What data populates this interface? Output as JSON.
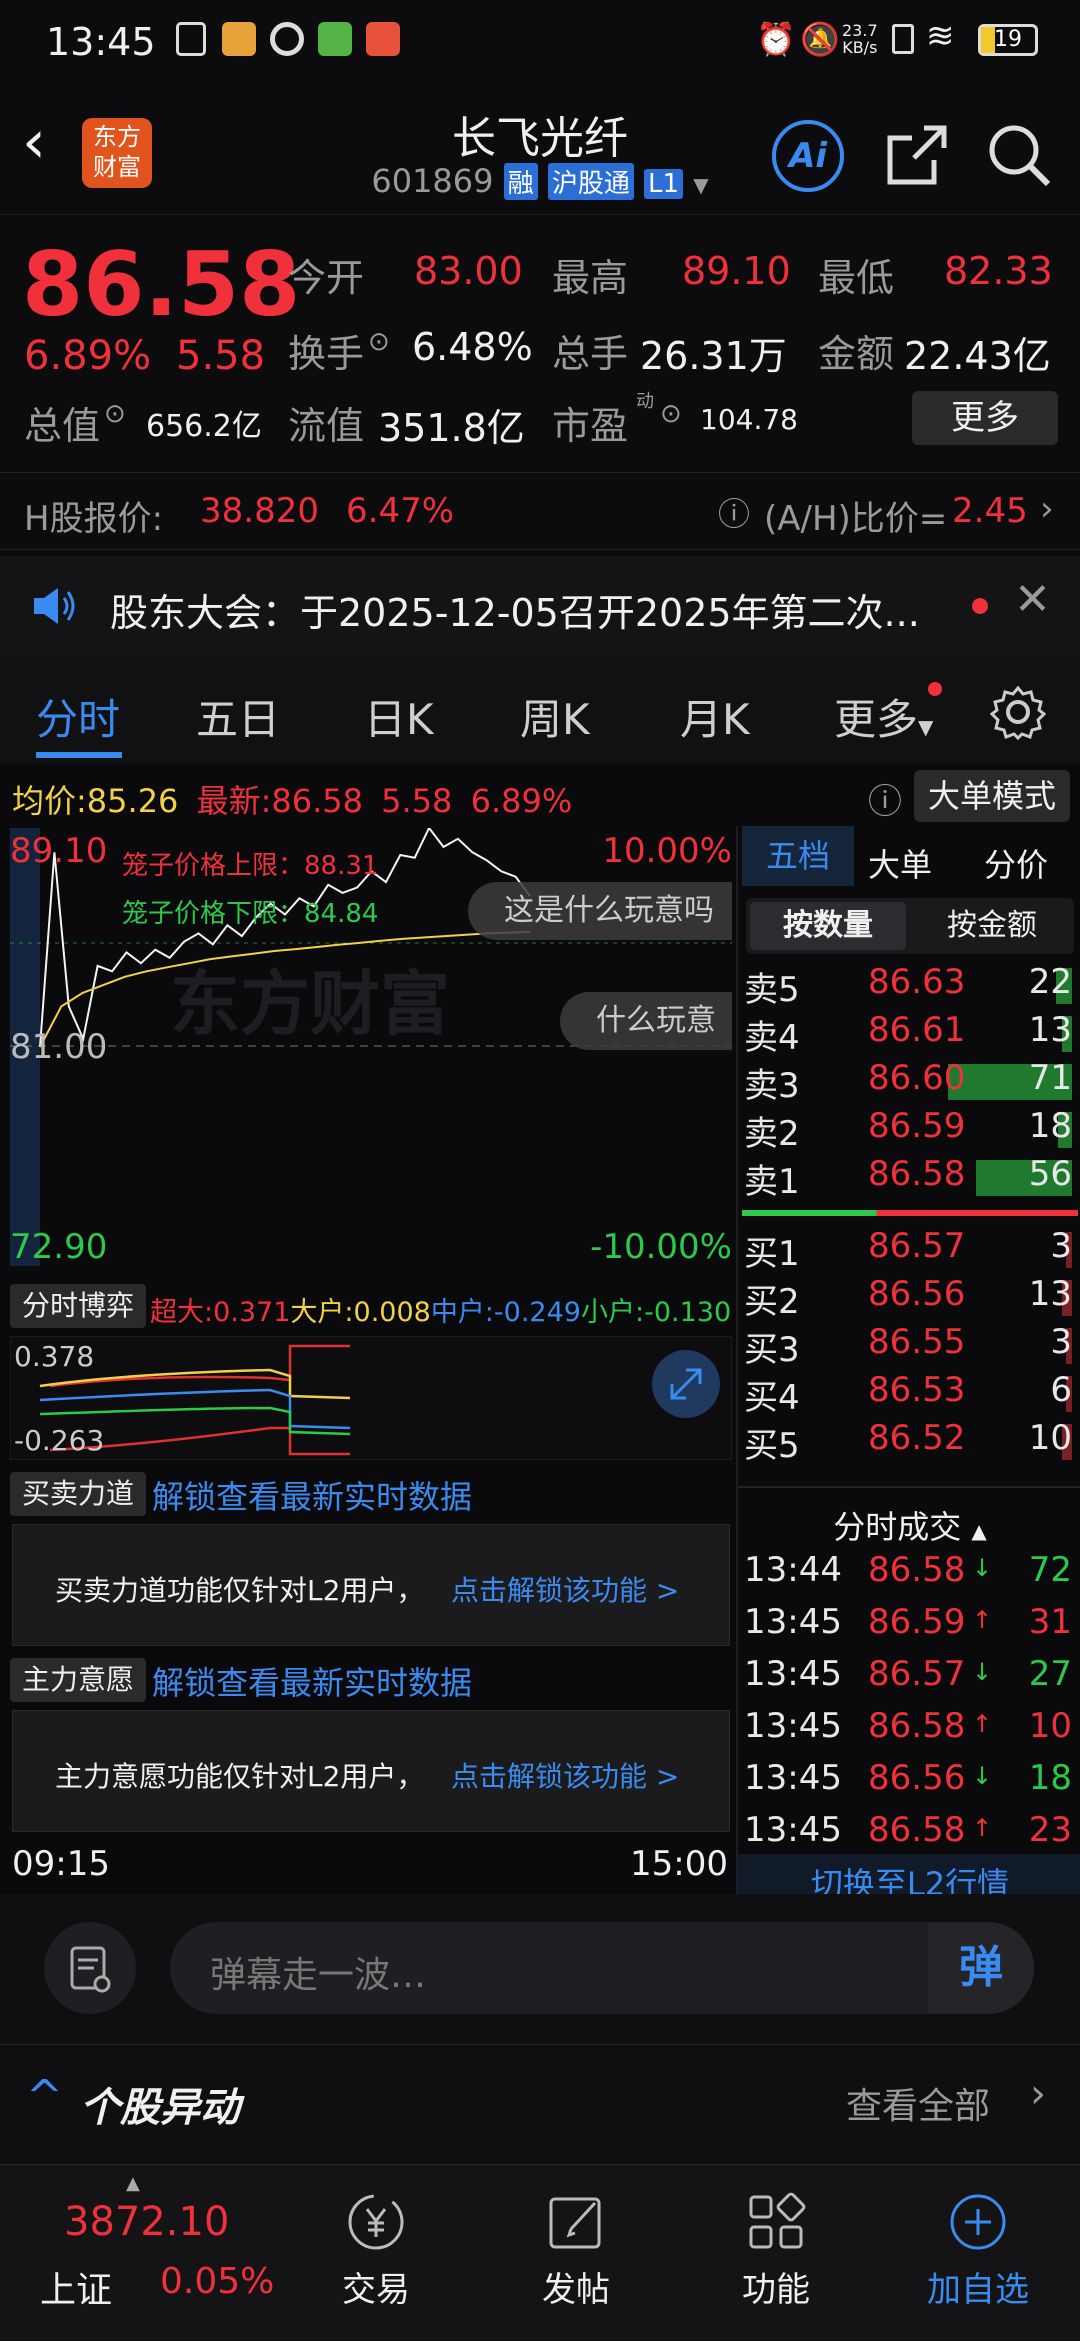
{
  "status_bar": {
    "time": "13:45",
    "net_speed": "23.7",
    "net_unit": "KB/s",
    "battery": "19"
  },
  "header": {
    "title": "长飞光纤",
    "code": "601869",
    "badge_rong": "融",
    "badge_hgt": "沪股通",
    "badge_l1": "L1",
    "logo_line1": "东方",
    "logo_line2": "财富",
    "ai_label": "Ai"
  },
  "quote": {
    "price": "86.58",
    "pct": "6.89%",
    "chg": "5.58",
    "open_label": "今开",
    "open": "83.00",
    "high_label": "最高",
    "high": "89.10",
    "low_label": "最低",
    "low": "82.33",
    "turnover_label": "换手",
    "turnover": "6.48%",
    "volume_label": "总手",
    "volume": "26.31万",
    "amount_label": "金额",
    "amount": "22.43亿",
    "mcap_label": "总值",
    "mcap": "656.2亿",
    "float_label": "流值",
    "float": "351.8亿",
    "pe_label": "市盈",
    "pe_sup": "动",
    "pe": "104.78",
    "more_btn": "更多"
  },
  "hshare": {
    "label": "H股报价:",
    "price": "38.820",
    "pct": "6.47%",
    "ah_label": "(A/H)比价=",
    "ah_value": "2.45"
  },
  "notice": {
    "text": "股东大会：于2025-12-05召开2025年第二次..."
  },
  "tabs": [
    "分时",
    "五日",
    "日K",
    "周K",
    "月K",
    "更多"
  ],
  "chart": {
    "avg_label": "均价:",
    "avg": "85.26",
    "latest_label": "最新:",
    "latest": "86.58",
    "latest_chg": "5.58",
    "latest_pct": "6.89%",
    "big_order_btn": "大单模式",
    "y_top": "89.10",
    "y_mid": "81.00",
    "y_bottom": "72.90",
    "pct_top": "10.00%",
    "pct_bottom": "-10.00%",
    "cage_upper": "笼子价格上限：88.31",
    "cage_lower": "笼子价格下限：84.84",
    "watermark": "东方财富",
    "danmu1": "这是什么玩意吗",
    "danmu2": "什么玩意",
    "time_start": "09:15",
    "time_end": "15:00",
    "intraday_line": [
      81.0,
      88.2,
      82.5,
      81.3,
      84.0,
      83.8,
      84.5,
      84.1,
      84.6,
      84.3,
      84.9,
      85.2,
      84.8,
      85.5,
      85.1,
      85.8,
      86.3,
      85.9,
      86.5,
      86.2,
      87.0,
      86.7,
      86.9,
      87.5,
      87.1,
      88.1,
      88.0,
      89.1,
      88.4,
      88.7,
      88.2,
      87.9,
      87.5,
      87.3,
      86.58
    ],
    "avg_line": [
      81.0,
      82.5,
      83.0,
      83.3,
      83.6,
      83.8,
      83.95,
      84.1,
      84.25,
      84.35,
      84.45,
      84.55,
      84.62,
      84.7,
      84.78,
      84.85,
      84.93,
      85.0,
      85.05,
      85.1,
      85.15,
      85.2,
      85.23,
      85.26
    ]
  },
  "capital": {
    "selector": "分时博弈",
    "super_label": "超大:",
    "super": "0.371",
    "big_label": "大户:",
    "big": "0.008",
    "mid_label": "中户:",
    "mid": "-0.249",
    "small_label": "小户:",
    "small": "-0.130",
    "y_top": "0.378",
    "y_bottom": "-0.263"
  },
  "force": {
    "selector": "买卖力道",
    "unlock": "解锁查看最新实时数据",
    "msg": "买卖力道功能仅针对L2用户，",
    "link": "点击解锁该功能 >"
  },
  "will": {
    "selector": "主力意愿",
    "unlock": "解锁查看最新实时数据",
    "msg": "主力意愿功能仅针对L2用户，",
    "link": "点击解锁该功能 >"
  },
  "orderbook": {
    "tabs": [
      "五档",
      "大单",
      "分价"
    ],
    "mode_tabs": [
      "按数量",
      "按金额"
    ],
    "asks": [
      {
        "label": "卖5",
        "price": "86.63",
        "vol": "22",
        "bar": 0.08
      },
      {
        "label": "卖4",
        "price": "86.61",
        "vol": "13",
        "bar": 0.05
      },
      {
        "label": "卖3",
        "price": "86.60",
        "vol": "71",
        "bar": 0.62
      },
      {
        "label": "卖2",
        "price": "86.59",
        "vol": "18",
        "bar": 0.07
      },
      {
        "label": "卖1",
        "price": "86.58",
        "vol": "56",
        "bar": 0.48
      }
    ],
    "bids": [
      {
        "label": "买1",
        "price": "86.57",
        "vol": "3",
        "bar": 0.03
      },
      {
        "label": "买2",
        "price": "86.56",
        "vol": "13",
        "bar": 0.05
      },
      {
        "label": "买3",
        "price": "86.55",
        "vol": "3",
        "bar": 0.03
      },
      {
        "label": "买4",
        "price": "86.53",
        "vol": "6",
        "bar": 0.03
      },
      {
        "label": "买5",
        "price": "86.52",
        "vol": "10",
        "bar": 0.05
      }
    ],
    "trades_title": "分时成交",
    "trades": [
      {
        "time": "13:44",
        "price": "86.58",
        "dir": "down",
        "vol": "72"
      },
      {
        "time": "13:45",
        "price": "86.59",
        "dir": "up",
        "vol": "31"
      },
      {
        "time": "13:45",
        "price": "86.57",
        "dir": "down",
        "vol": "27"
      },
      {
        "time": "13:45",
        "price": "86.58",
        "dir": "up",
        "vol": "10"
      },
      {
        "time": "13:45",
        "price": "86.56",
        "dir": "down",
        "vol": "18"
      },
      {
        "time": "13:45",
        "price": "86.58",
        "dir": "up",
        "vol": "23"
      }
    ],
    "switch_l2": "切换至L2行情"
  },
  "danmu": {
    "placeholder": "弹幕走一波…",
    "send": "弹"
  },
  "movers": {
    "title": "个股异动",
    "view_all": "查看全部"
  },
  "bottom_nav": {
    "index_value": "3872.10",
    "index_name": "上证",
    "index_pct": "0.05%",
    "items": [
      "交易",
      "发帖",
      "功能",
      "加自选"
    ]
  },
  "colors": {
    "up": "#f0303a",
    "down": "#2cc94a",
    "accent": "#3a8bf0",
    "avg": "#f2d14a"
  }
}
